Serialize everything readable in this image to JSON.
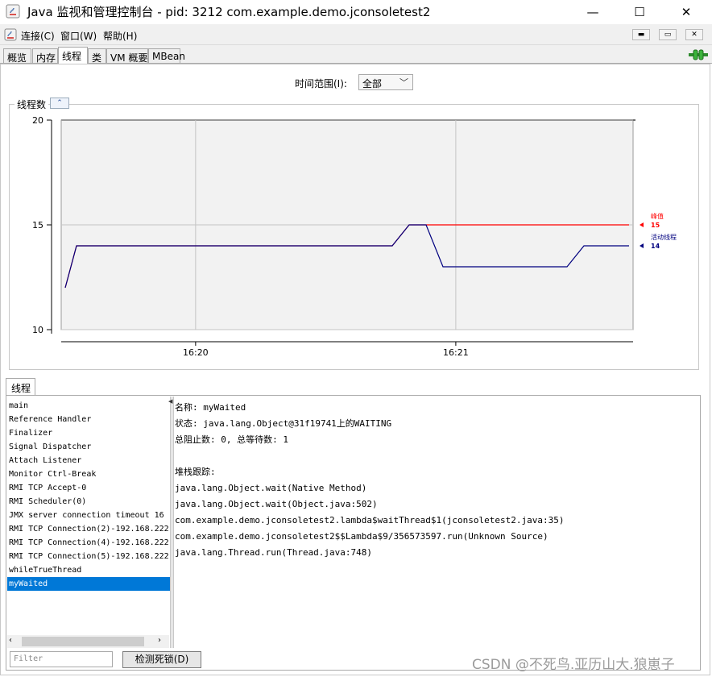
{
  "window": {
    "title": "Java 监视和管理控制台 - pid: 3212 com.example.demo.jconsoletest2",
    "minimize_glyph": "—",
    "maximize_glyph": "☐",
    "close_glyph": "✕"
  },
  "menu": [
    "连接(C)",
    "窗口(W)",
    "帮助(H)"
  ],
  "mdi_buttons": [
    "▬",
    "▭",
    "✕"
  ],
  "tabs": [
    "概览",
    "内存",
    "线程",
    "类",
    "VM 概要",
    "MBean"
  ],
  "active_tab": "线程",
  "time_range": {
    "label": "时间范围(I):",
    "value": "全部"
  },
  "chart": {
    "title": "线程数",
    "collapse_glyph": "⌃"
  },
  "chart_data": {
    "type": "line",
    "ylim": [
      10,
      20
    ],
    "yticks": [
      "20",
      "15",
      "10"
    ],
    "xticks": [
      "16:20",
      "16:21"
    ],
    "series": [
      {
        "name": "峰值",
        "color": "#ff0000",
        "current": "15",
        "points": [
          [
            0.0,
            12
          ],
          [
            0.02,
            14
          ],
          [
            0.58,
            14
          ],
          [
            0.61,
            15
          ],
          [
            1.0,
            15
          ]
        ]
      },
      {
        "name": "活动线程",
        "color": "#00007f",
        "current": "14",
        "points": [
          [
            0.0,
            12
          ],
          [
            0.02,
            14
          ],
          [
            0.58,
            14
          ],
          [
            0.61,
            15
          ],
          [
            0.64,
            15
          ],
          [
            0.67,
            13
          ],
          [
            0.89,
            13
          ],
          [
            0.92,
            14
          ],
          [
            1.0,
            14
          ]
        ]
      }
    ]
  },
  "threads": {
    "tab_label": "线程",
    "list": [
      "main",
      "Reference Handler",
      "Finalizer",
      "Signal Dispatcher",
      "Attach Listener",
      "Monitor Ctrl-Break",
      "RMI TCP Accept-0",
      "RMI Scheduler(0)",
      "JMX server connection timeout 16",
      "RMI TCP Connection(2)-192.168.222",
      "RMI TCP Connection(4)-192.168.222",
      "RMI TCP Connection(5)-192.168.222",
      "whileTrueThread",
      "myWaited"
    ],
    "selected_index": 13,
    "filter_placeholder": "Filter",
    "detect_deadlock_label": "检测死锁(D)",
    "details": [
      "名称: myWaited",
      "状态: java.lang.Object@31f19741上的WAITING",
      "总阻止数: 0, 总等待数: 1",
      "",
      "堆栈跟踪:",
      "java.lang.Object.wait(Native Method)",
      "java.lang.Object.wait(Object.java:502)",
      "com.example.demo.jconsoletest2.lambda$waitThread$1(jconsoletest2.java:35)",
      "com.example.demo.jconsoletest2$$Lambda$9/356573597.run(Unknown Source)",
      "java.lang.Thread.run(Thread.java:748)"
    ]
  },
  "watermark": "CSDN @不死鸟.亚历山大.狼崽子"
}
